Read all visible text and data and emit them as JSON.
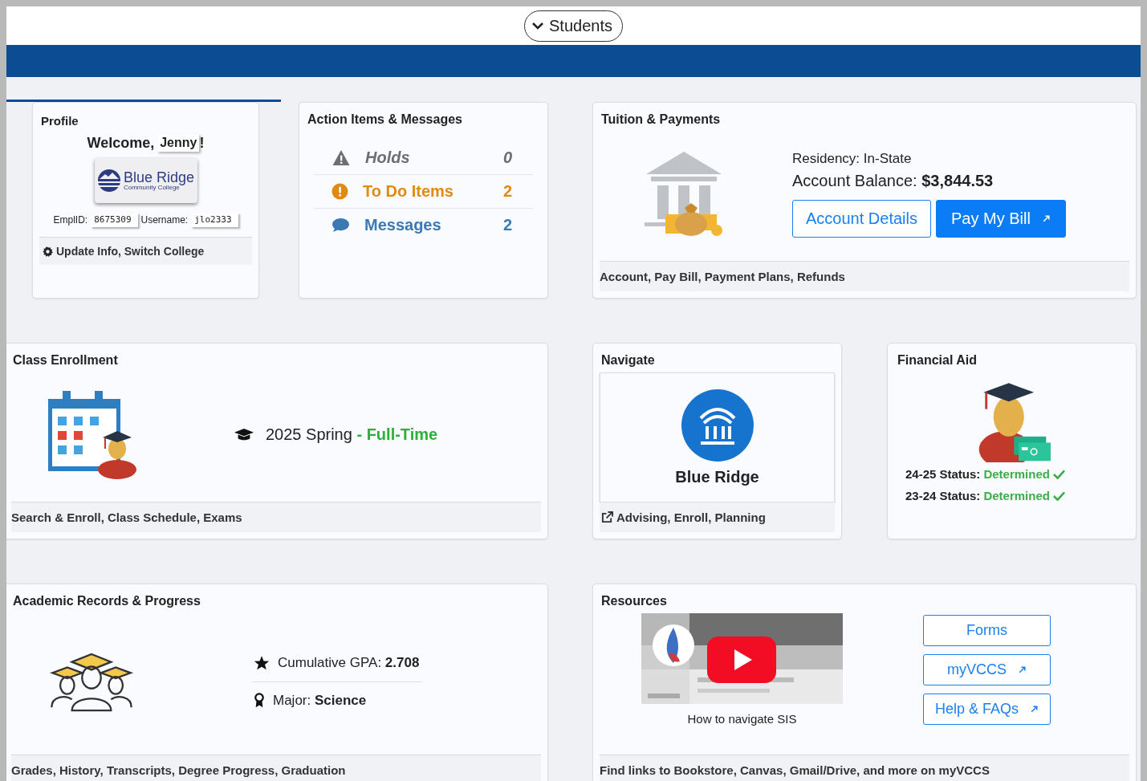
{
  "header": {
    "button": "Students"
  },
  "profile": {
    "title": "Profile",
    "welcome": "Welcome,",
    "name": "Jenny",
    "exclaim": "!",
    "logo": {
      "name": "Blue Ridge",
      "sub": "Community College"
    },
    "fields": [
      {
        "label": "EmplID:",
        "value": "8675309"
      },
      {
        "label": "Username:",
        "value": "jlo2333"
      }
    ],
    "footer": "Update Info, Switch College"
  },
  "actions": {
    "title": "Action Items & Messages",
    "items": [
      {
        "kind": "holds",
        "label": "Holds",
        "count": "0"
      },
      {
        "kind": "todo",
        "label": "To Do Items",
        "count": "2"
      },
      {
        "kind": "messages",
        "label": "Messages",
        "count": "2"
      }
    ]
  },
  "tuition": {
    "title": "Tuition & Payments",
    "residency": "Residency: In-State",
    "balance_label": "Account Balance:",
    "balance": "$3,844.53",
    "buttons": [
      {
        "kind": "outline",
        "label": "Account Details",
        "external": false
      },
      {
        "kind": "solid",
        "label": "Pay My Bill",
        "external": true
      }
    ],
    "footer": "Account, Pay Bill, Payment Plans, Refunds"
  },
  "enrollment": {
    "title": "Class Enrollment",
    "term": "2025 Spring",
    "status": "- Full-Time",
    "footer": "Search & Enroll, Class Schedule, Exams"
  },
  "navigate": {
    "title": "Navigate",
    "app": "Blue Ridge",
    "footer": "Advising, Enroll, Planning"
  },
  "financial_aid": {
    "title": "Financial Aid",
    "statuses": [
      {
        "label": "24-25 Status:",
        "value": "Determined",
        "done": true
      },
      {
        "label": "23-24 Status:",
        "value": "Determined",
        "done": true
      }
    ]
  },
  "records": {
    "title": "Academic Records & Progress",
    "stats": [
      {
        "kind": "gpa",
        "label": "Cumulative GPA:",
        "value": "2.708"
      },
      {
        "kind": "major",
        "label": "Major:",
        "value": "Science"
      }
    ],
    "footer": "Grades, History, Transcripts, Degree Progress, Graduation"
  },
  "resources": {
    "title": "Resources",
    "video": {
      "caption": "How to navigate SIS"
    },
    "links": [
      {
        "label": "Forms",
        "external": false
      },
      {
        "label": "myVCCS",
        "external": true
      },
      {
        "label": "Help & FAQs",
        "external": true
      }
    ],
    "footer": "Find links to Bookstore, Canvas, Gmail/Drive, and more on myVCCS"
  }
}
